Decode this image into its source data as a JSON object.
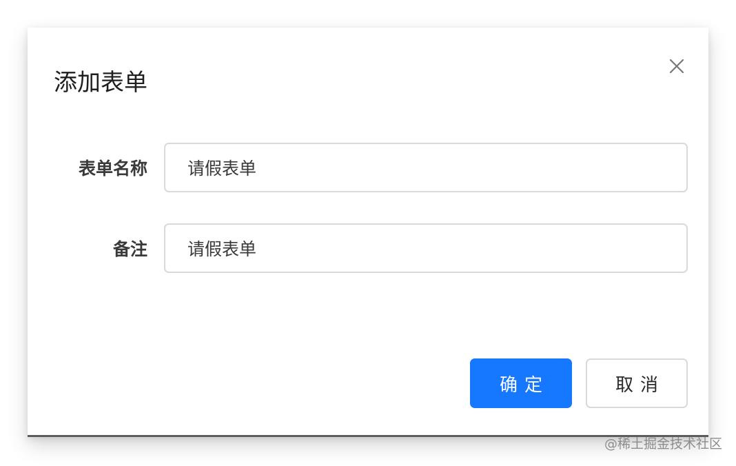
{
  "dialog": {
    "title": "添加表单",
    "close_icon": "close-icon"
  },
  "form": {
    "fields": [
      {
        "label": "表单名称",
        "value": "请假表单"
      },
      {
        "label": "备注",
        "value": "请假表单"
      }
    ]
  },
  "footer": {
    "ok_label": "确定",
    "cancel_label": "取消"
  },
  "colors": {
    "primary": "#1677ff",
    "border": "#d9d9d9",
    "text": "#3a3a3a"
  },
  "watermark": "@稀土掘金技术社区"
}
